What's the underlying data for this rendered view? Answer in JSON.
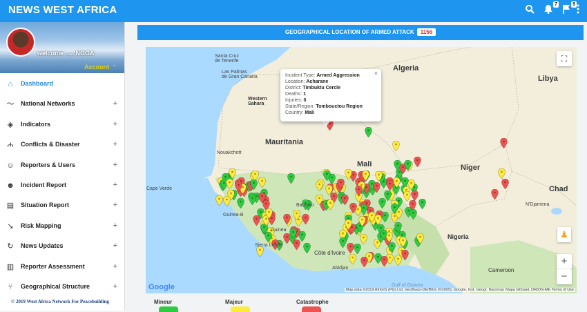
{
  "app": {
    "brand": "NEWS WEST AFRICA"
  },
  "topbar": {
    "alerts_count": "7",
    "flags_count": "9"
  },
  "profile": {
    "welcome": "welcome ..... NGGA",
    "account": "Account"
  },
  "sidebar": {
    "items": [
      {
        "label": "Dashboard",
        "icon": "home-icon",
        "glyph": "⌂"
      },
      {
        "label": "National Networks",
        "icon": "trend-icon",
        "glyph": "〜"
      },
      {
        "label": "Indicators",
        "icon": "layers-icon",
        "glyph": "◈"
      },
      {
        "label": "Conflicts & Disaster",
        "icon": "people-icon",
        "glyph": "ሐ"
      },
      {
        "label": "Reporters & Users",
        "icon": "user-add-icon",
        "glyph": "☺"
      },
      {
        "label": "Incident Report",
        "icon": "face-icon",
        "glyph": "☻"
      },
      {
        "label": "Situation Report",
        "icon": "clipboard-icon",
        "glyph": "▤"
      },
      {
        "label": "Risk Mapping",
        "icon": "trending-icon",
        "glyph": "↘"
      },
      {
        "label": "News Updates",
        "icon": "refresh-icon",
        "glyph": "↻"
      },
      {
        "label": "Reporter Assessment",
        "icon": "bar-chart-icon",
        "glyph": "▥"
      },
      {
        "label": "Geographical Structure",
        "icon": "network-icon",
        "glyph": "⑂"
      }
    ],
    "plus": "+"
  },
  "footer": {
    "text": "© 2019 West Africa Network For Peacebuilding"
  },
  "panel": {
    "title": "GEOGRAPHICAL LOCATION OF ARMED ATTACK",
    "count": "1156"
  },
  "map": {
    "labels": {
      "algeria": "Algeria",
      "libya": "Libya",
      "mauritania": "Mauritania",
      "mali": "Mali",
      "niger": "Niger",
      "chad": "Chad",
      "nigeria": "Nigeria",
      "western_sahara": "Western\nSahara",
      "cape_verde": "Cape Verde",
      "cote_divoire": "Côte d'Ivoire",
      "cameroon": "Cameroon",
      "sierra_leone": "Sierra Leone",
      "guinea": "Guinea",
      "guinea_b": "Guinea-B",
      "nouakchott": "Nouakchott",
      "ndjamena": "N'Djamena",
      "santa_cruz": "Santa Cruz\nde Tenerife",
      "las_palmas": "Las Palmas\nde Gran Canaria",
      "abidjan": "Abidjan",
      "bamako": "Bamako",
      "gulf_guinea": "Gulf of Guinea"
    },
    "popup": {
      "type_label": "Incident Type:",
      "type": "Armed Aggression",
      "location_label": "Location:",
      "location": "Acharane",
      "district_label": "District:",
      "district": "Timbuktu Cercle",
      "deaths_label": "Deaths:",
      "deaths": "1",
      "injuries_label": "Injuries:",
      "injuries": "0",
      "state_label": "State/Region:",
      "state": "Tombouctou Region",
      "country_label": "Country:",
      "country": "Mali",
      "close": "×"
    },
    "google": "Google",
    "attribution": "Map data ©2019 AfriGIS (Pty) Ltd, GeoBasis-DE/BKG (©2009), Google, Inst. Geogr. Nacional, Mapa GISrael, ORION-ME   Terms of Use",
    "zoom_in": "+",
    "zoom_out": "−",
    "fullscreen": "⛶",
    "pegman": "♟"
  },
  "legend": {
    "minor": "Mineur",
    "major": "Majeur",
    "catastrophe": "Catastrophe"
  },
  "colors": {
    "minor": "#2ecc40",
    "major": "#ffeb3b",
    "catastrophe": "#ef5350",
    "accent": "#1e96f0"
  }
}
